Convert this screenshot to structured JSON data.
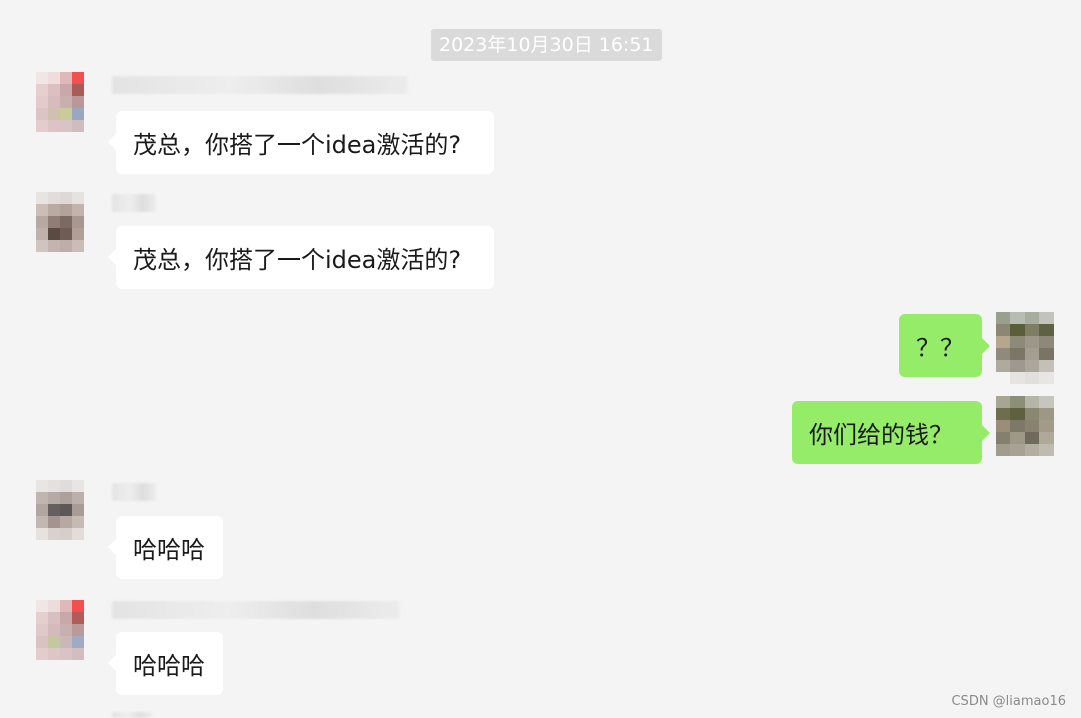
{
  "header": {
    "timestamp": "2023年10月30日 16:51"
  },
  "messages": [
    {
      "side": "left",
      "text": "茂总，你搭了一个idea激活的?"
    },
    {
      "side": "left",
      "text": "茂总，你搭了一个idea激活的?"
    },
    {
      "side": "right",
      "text": "？？"
    },
    {
      "side": "right",
      "text": "你们给的钱？"
    },
    {
      "side": "left",
      "text": "哈哈哈"
    },
    {
      "side": "left",
      "text": "哈哈哈"
    }
  ],
  "colors": {
    "background": "#f4f4f4",
    "incoming_bubble": "#ffffff",
    "outgoing_bubble": "#95ec69",
    "timestamp_bg": "#dadada"
  },
  "watermark": "CSDN @liamao16"
}
